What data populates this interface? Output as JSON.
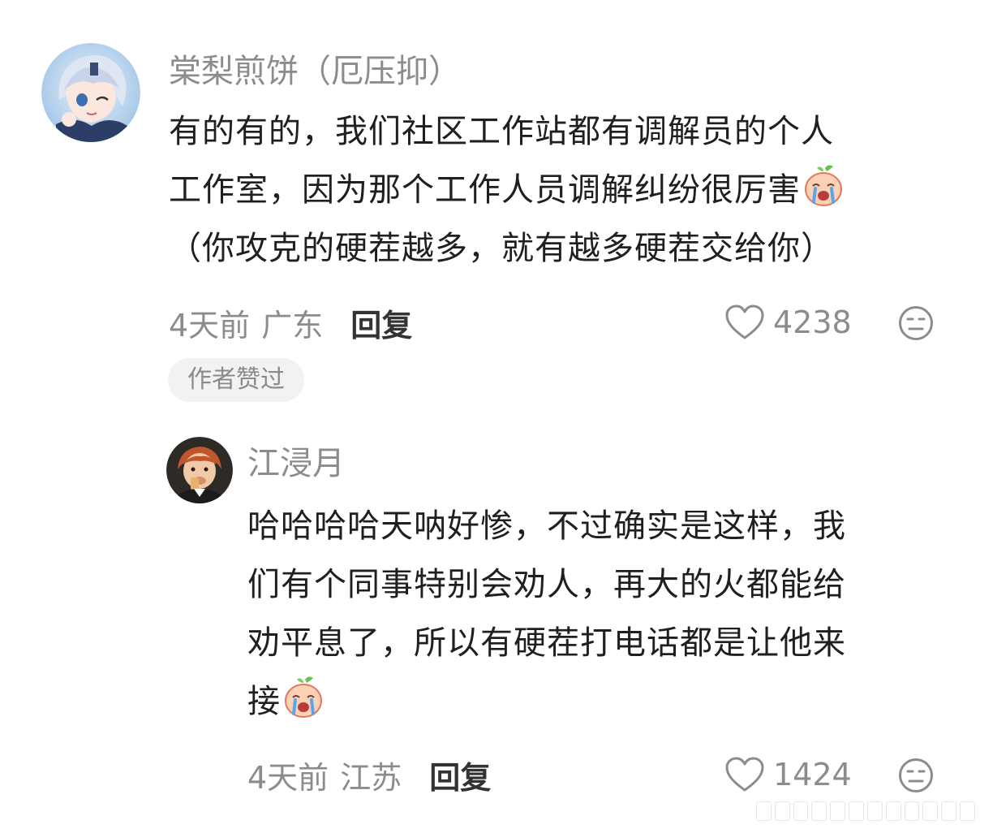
{
  "comment": {
    "username": "棠梨煎饼（厄压抑）",
    "lines": [
      "有的有的，我们社区工作站都有调解员的个人",
      "工作室，因为那个工作人员调解纠纷很厉害",
      "（你攻克的硬茬越多，就有越多硬茬交给你）"
    ],
    "time": "4天前",
    "location": "广东",
    "reply_label": "回复",
    "likes": "4238",
    "badge": "作者赞过",
    "inline_emoji": "crying-peach-emoji"
  },
  "reply": {
    "username": "江浸月",
    "lines": [
      "哈哈哈哈天呐好惨，不过确实是这样，我",
      "们有个同事特别会劝人，再大的火都能给",
      "劝平息了，所以有硬茬打电话都是让他来",
      "接"
    ],
    "time": "4天前",
    "location": "江苏",
    "reply_label": "回复",
    "likes": "1424",
    "inline_emoji": "crying-peach-emoji"
  },
  "colors": {
    "secondary_text": "#8c8c8c",
    "primary_text": "#1f1f1f",
    "badge_bg": "#f2f2f2"
  },
  "icons": {
    "like": "heart-outline-icon",
    "dislike": "meh-face-icon"
  }
}
